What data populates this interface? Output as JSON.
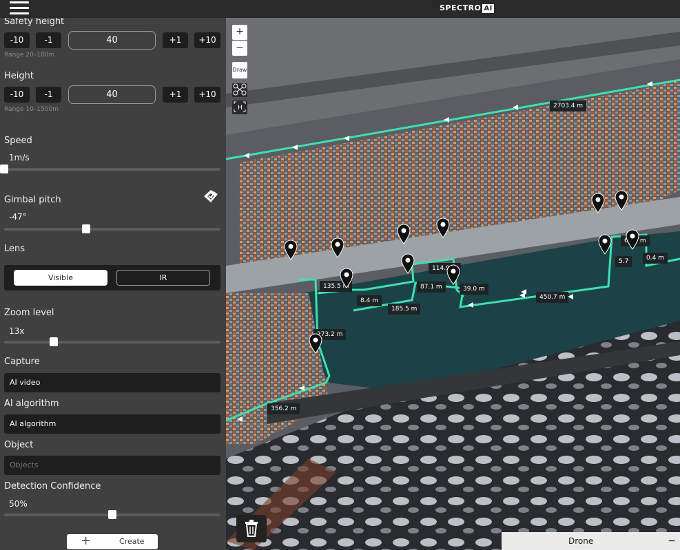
{
  "app": {
    "brand": "SPECTRO",
    "brand_badge": "AI"
  },
  "panel": {
    "safety_height": {
      "label": "Safety height",
      "minus10": "-10",
      "minus1": "-1",
      "value": "40",
      "plus1": "+1",
      "plus10": "+10",
      "range": "Range 20–100m"
    },
    "height": {
      "label": "Height",
      "minus10": "-10",
      "minus1": "-1",
      "value": "40",
      "plus1": "+1",
      "plus10": "+10",
      "range": "Range 10–1500m"
    },
    "speed": {
      "label": "Speed",
      "value": "1m/s",
      "slider_fraction": 0.0
    },
    "gimbal": {
      "label": "Gimbal pitch",
      "value": "-47°",
      "slider_fraction": 0.38
    },
    "lens": {
      "label": "Lens",
      "options": [
        "Visible",
        "IR"
      ],
      "selected": "Visible"
    },
    "zoom": {
      "label": "Zoom level",
      "value": "13x",
      "slider_fraction": 0.23
    },
    "capture": {
      "label": "Capture",
      "value": "AI video"
    },
    "ai_algorithm": {
      "label": "AI algorithm",
      "value": "AI algorithm"
    },
    "object": {
      "label": "Object",
      "placeholder": "Objects"
    },
    "confidence": {
      "label": "Detection Confidence",
      "value": "50%",
      "slider_fraction": 0.5
    },
    "create_label": "Create"
  },
  "map": {
    "zoom_in": "+",
    "zoom_out": "−",
    "draw_label": "Draw",
    "distances": [
      "2703.4 m",
      "65.0 m",
      "5.7",
      "0.4 m",
      "114.9 m",
      "135.5 m",
      "87.1 m",
      "39.0 m",
      "450.7 m",
      "8.4 m",
      "185.5 m",
      "273.2 m",
      "356.2 m"
    ],
    "drone_label": "Drone",
    "drone_toggle": "−",
    "route_color": "#3ee0b0"
  }
}
